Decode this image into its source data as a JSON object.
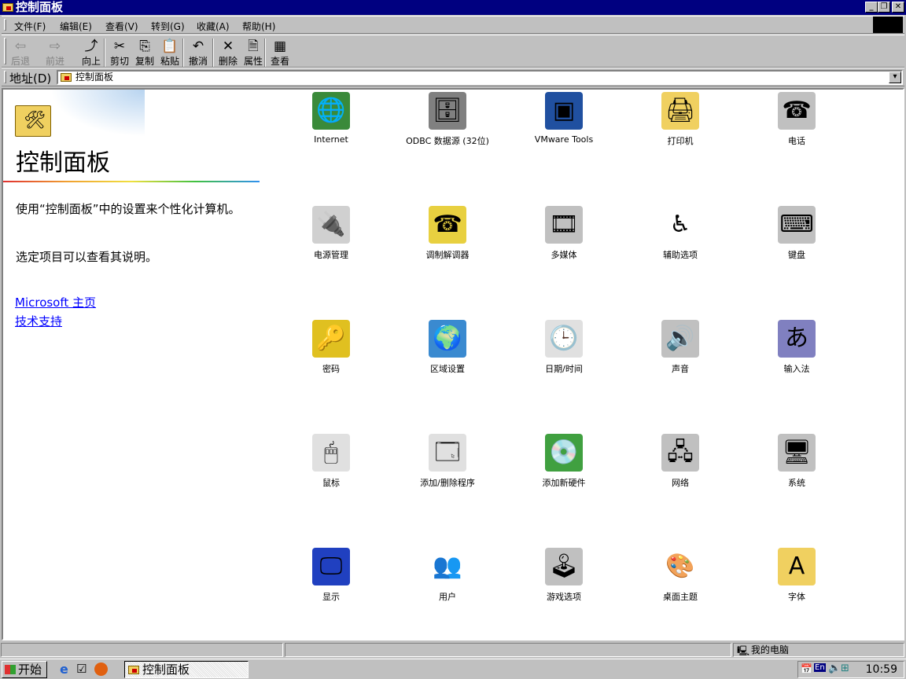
{
  "window": {
    "title": "控制面板"
  },
  "menu": [
    "文件(F)",
    "编辑(E)",
    "查看(V)",
    "转到(G)",
    "收藏(A)",
    "帮助(H)"
  ],
  "toolbar": [
    {
      "label": "后退",
      "icon": "back-arrow-icon",
      "glyph": "⇦",
      "disabled": true
    },
    {
      "label": "前进",
      "icon": "forward-arrow-icon",
      "glyph": "⇨",
      "disabled": true
    },
    {
      "label": "向上",
      "icon": "up-folder-icon",
      "glyph": "⤴",
      "disabled": false
    },
    {
      "label": "剪切",
      "icon": "scissors-icon",
      "glyph": "✂",
      "disabled": false
    },
    {
      "label": "复制",
      "icon": "copy-icon",
      "glyph": "⎘",
      "disabled": false
    },
    {
      "label": "粘贴",
      "icon": "paste-icon",
      "glyph": "📋",
      "disabled": false
    },
    {
      "label": "撤消",
      "icon": "undo-icon",
      "glyph": "↶",
      "disabled": false
    },
    {
      "label": "删除",
      "icon": "delete-icon",
      "glyph": "✕",
      "disabled": false
    },
    {
      "label": "属性",
      "icon": "properties-icon",
      "glyph": "🗎",
      "disabled": false
    },
    {
      "label": "查看",
      "icon": "view-icon",
      "glyph": "▦",
      "disabled": false
    }
  ],
  "address": {
    "label": "地址(D)",
    "value": "控制面板"
  },
  "left_panel": {
    "title": "控制面板",
    "desc1": "使用“控制面板”中的设置来个性化计算机。",
    "desc2": "选定项目可以查看其说明。",
    "links": [
      "Microsoft 主页",
      "技术支持"
    ]
  },
  "items": [
    {
      "label": "Internet",
      "icon": "internet-globe-icon",
      "glyph": "🌐",
      "color": "#3a8a3a"
    },
    {
      "label": "ODBC 数据源 (32位)",
      "icon": "odbc-database-icon",
      "glyph": "🗄",
      "color": "#808080"
    },
    {
      "label": "VMware Tools",
      "icon": "vmware-icon",
      "glyph": "▣",
      "color": "#2050a0"
    },
    {
      "label": "打印机",
      "icon": "printer-folder-icon",
      "glyph": "🖨",
      "color": "#f0d060"
    },
    {
      "label": "电话",
      "icon": "telephone-icon",
      "glyph": "☎",
      "color": "#c0c0c0"
    },
    {
      "label": "电源管理",
      "icon": "power-management-icon",
      "glyph": "🔌",
      "color": "#d0d0d0"
    },
    {
      "label": "调制解调器",
      "icon": "modem-icon",
      "glyph": "☎",
      "color": "#e8d040"
    },
    {
      "label": "多媒体",
      "icon": "multimedia-icon",
      "glyph": "🎞",
      "color": "#c0c0c0"
    },
    {
      "label": "辅助选项",
      "icon": "accessibility-icon",
      "glyph": "♿",
      "color": "#ffffff"
    },
    {
      "label": "键盘",
      "icon": "keyboard-icon",
      "glyph": "⌨",
      "color": "#c0c0c0"
    },
    {
      "label": "密码",
      "icon": "keys-icon",
      "glyph": "🔑",
      "color": "#e0c020"
    },
    {
      "label": "区域设置",
      "icon": "regional-globe-icon",
      "glyph": "🌍",
      "color": "#3a8ad0"
    },
    {
      "label": "日期/时间",
      "icon": "calendar-clock-icon",
      "glyph": "🕒",
      "color": "#e0e0e0"
    },
    {
      "label": "声音",
      "icon": "sound-speaker-icon",
      "glyph": "🔊",
      "color": "#c0c0c0"
    },
    {
      "label": "输入法",
      "icon": "input-method-icon",
      "glyph": "あ",
      "color": "#8080c0"
    },
    {
      "label": "鼠标",
      "icon": "mouse-icon",
      "glyph": "🖱",
      "color": "#e0e0e0"
    },
    {
      "label": "添加/删除程序",
      "icon": "add-remove-programs-icon",
      "glyph": "🗔",
      "color": "#e0e0e0"
    },
    {
      "label": "添加新硬件",
      "icon": "add-hardware-icon",
      "glyph": "💿",
      "color": "#40a040"
    },
    {
      "label": "网络",
      "icon": "network-icon",
      "glyph": "🖧",
      "color": "#c0c0c0"
    },
    {
      "label": "系统",
      "icon": "system-computer-icon",
      "glyph": "🖥",
      "color": "#c0c0c0"
    },
    {
      "label": "显示",
      "icon": "display-icon",
      "glyph": "🖵",
      "color": "#2040c0"
    },
    {
      "label": "用户",
      "icon": "users-icon",
      "glyph": "👥",
      "color": "#ffffff"
    },
    {
      "label": "游戏选项",
      "icon": "joystick-icon",
      "glyph": "🕹",
      "color": "#c0c0c0"
    },
    {
      "label": "桌面主题",
      "icon": "desktop-themes-icon",
      "glyph": "🎨",
      "color": "#ffffff"
    },
    {
      "label": "字体",
      "icon": "fonts-folder-icon",
      "glyph": "A",
      "color": "#f0d060"
    }
  ],
  "status": {
    "zone": "我的电脑"
  },
  "taskbar": {
    "start": "开始",
    "task": "控制面板",
    "clock": "10:59",
    "lang": "En"
  }
}
